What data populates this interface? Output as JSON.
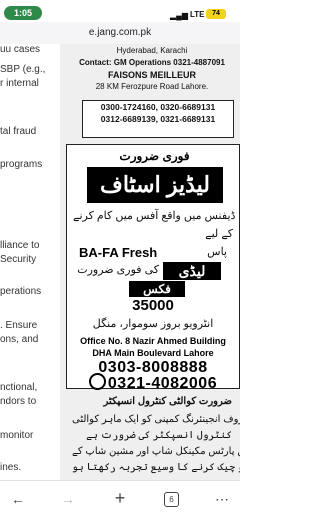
{
  "status": {
    "time": "1:05",
    "network": "LTE",
    "battery": "74"
  },
  "browser": {
    "url": "e.jang.com.pk"
  },
  "left_column": [
    "uu cases",
    "SBP (e.g.,",
    "r internal",
    "tal fraud",
    "programs",
    "lliance to",
    "Security",
    "perations",
    ". Ensure",
    "ons, and",
    "nctional,",
    "ndors to",
    "monitor",
    "ines."
  ],
  "ad_top": {
    "city_line": "Hyderabad, Karachi",
    "contact": "Contact: GM Operations 0321-4887091",
    "company": "FAISONS MEILLEUR",
    "address": "28 KM Ferozpure Road Lahore.",
    "phones": [
      "0300-1724160, 0320-6689131",
      "0312-6689139, 0321-6689131"
    ]
  },
  "ad_main": {
    "urdu_heading": "فوری ضرورت",
    "banner": "لیڈیز اسٹاف",
    "line1": "ڈیفنس میں واقع آفس میں کام کرنے",
    "line2": "کے لیے",
    "ba_fresh": "BA-FA Fresh",
    "line3": "پاس",
    "ladies": "لیڈی اسٹاف",
    "line4": "کی فوری ضرورت",
    "fix": "فکس سیلری",
    "salary": "35000",
    "interview": "انٹرویو بروز سوموار، منگل",
    "office_line1": "Office No. 8 Nazir Ahmed Building",
    "office_line2": "DHA Main Boulevard Lahore",
    "phone1": "0303-8008888",
    "phone2": "0321-4082006"
  },
  "ad_bottom": {
    "heading": "ضرورت کوالٹی کنٹرول انسپکٹر",
    "line1": "ایک معروف انجینئرنگ کمپنی کو ایک ماہر کوالٹی",
    "line2": "کنٹرول انسپکٹر کی ضرورت ہے",
    "line3": "جو انجن پارٹس مکینکل شاپ اور مشین شاپ کے",
    "line4": "کمپونینٹس کو چیک کرنے کا وسیع تجربہ رکھتا ہو"
  },
  "nav": {
    "back": "←",
    "forward": "→",
    "new_tab": "+",
    "tabs": "6",
    "more": "⋯"
  },
  "colors": {
    "time_pill": "#2f8a4a",
    "battery": "#f2d21b"
  }
}
